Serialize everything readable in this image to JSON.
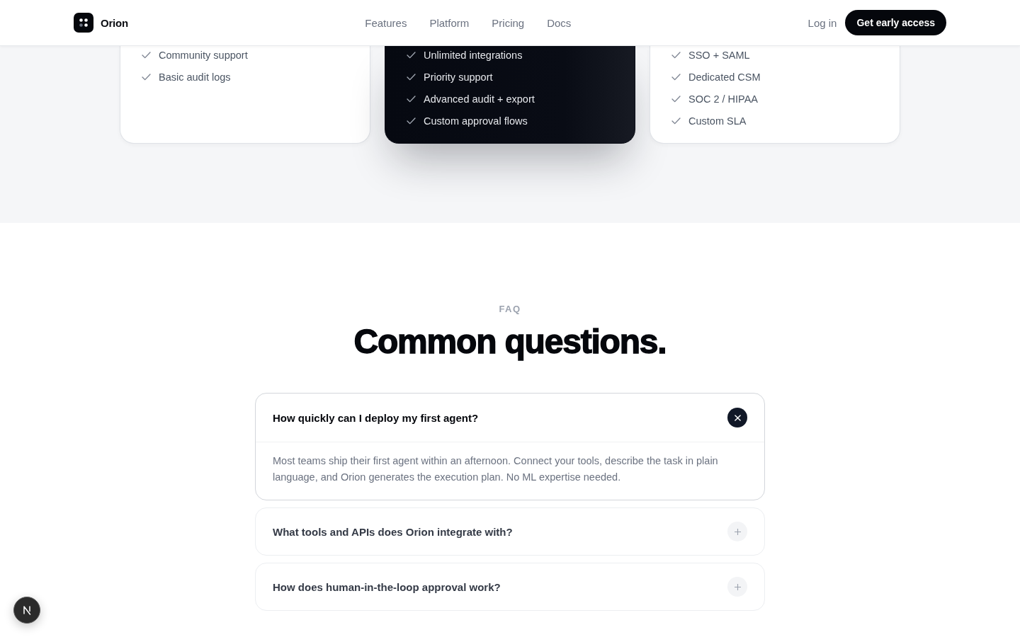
{
  "header": {
    "brand": "Orion",
    "nav": [
      "Features",
      "Platform",
      "Pricing",
      "Docs"
    ],
    "login": "Log in",
    "cta": "Get early access"
  },
  "pricing": {
    "plans": [
      {
        "featured": false,
        "features": [
          "Community support",
          "Basic audit logs"
        ]
      },
      {
        "featured": true,
        "features": [
          "Unlimited integrations",
          "Priority support",
          "Advanced audit + export",
          "Custom approval flows"
        ]
      },
      {
        "featured": false,
        "features": [
          "SSO + SAML",
          "Dedicated CSM",
          "SOC 2 / HIPAA",
          "Custom SLA"
        ]
      }
    ]
  },
  "faq": {
    "eyebrow": "FAQ",
    "title": "Common questions.",
    "items": [
      {
        "question": "How quickly can I deploy my first agent?",
        "expanded": true,
        "answer": "Most teams ship their first agent within an afternoon. Connect your tools, describe the task in plain language, and Orion generates the execution plan. No ML expertise needed."
      },
      {
        "question": "What tools and APIs does Orion integrate with?",
        "expanded": false
      },
      {
        "question": "How does human-in-the-loop approval work?",
        "expanded": false
      }
    ]
  }
}
